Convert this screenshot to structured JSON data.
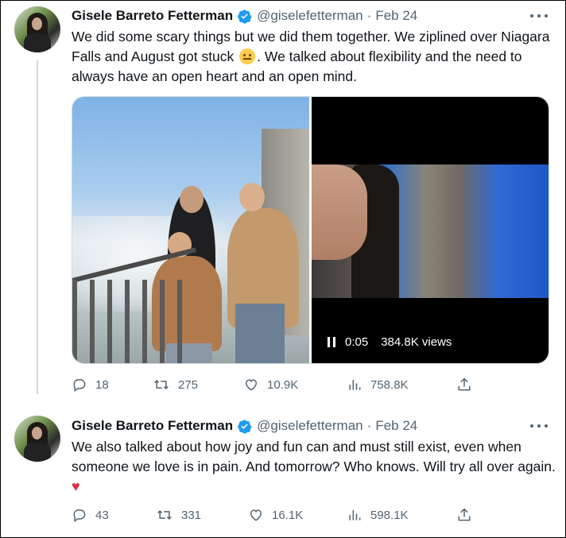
{
  "colors": {
    "text": "#0f1419",
    "muted": "#536471",
    "verified": "#1d9bf0",
    "border": "#cfd9de"
  },
  "tweets": [
    {
      "display_name": "Gisele Barreto Fetterman",
      "handle": "@giselefetterman",
      "date": "Feb 24",
      "text_part1": "We did some scary things but we did them together. We ziplined over Niagara Falls and August got stuck ",
      "text_part2": ".  We talked about flexibility and the need to always have an open heart and an open mind.",
      "video": {
        "time": "0:05",
        "views": "384.8K views"
      },
      "stats": {
        "replies": "18",
        "reposts": "275",
        "likes": "10.9K",
        "views": "758.8K"
      }
    },
    {
      "display_name": "Gisele Barreto Fetterman",
      "handle": "@giselefetterman",
      "date": "Feb 24",
      "text": "We also talked about how joy and fun can and must still exist, even when someone we love is in pain. And tomorrow? Who knows. Will try all over again. ",
      "emoji": "♥",
      "stats": {
        "replies": "43",
        "reposts": "331",
        "likes": "16.1K",
        "views": "598.1K"
      }
    }
  ]
}
